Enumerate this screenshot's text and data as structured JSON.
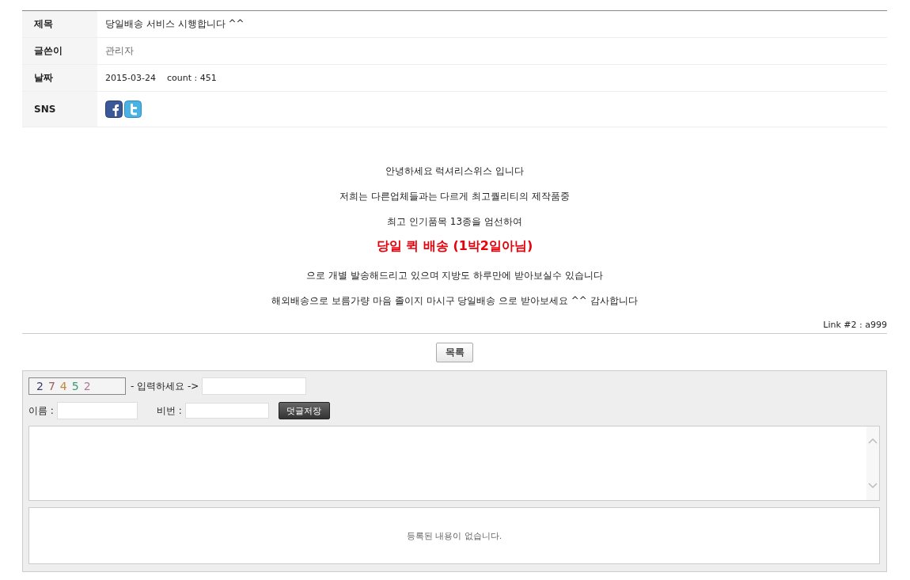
{
  "meta": [
    {
      "label": "제목",
      "kind": "text",
      "value": "당일배송 서비스 시행합니다 ^^"
    },
    {
      "label": "글쓴이",
      "kind": "muted",
      "value": "관리자"
    },
    {
      "label": "날짜",
      "kind": "date",
      "value": "2015-03-24",
      "count": "count : 451"
    },
    {
      "label": "SNS",
      "kind": "sns"
    }
  ],
  "body": [
    {
      "text": "안녕하세요 럭셔리스위스 입니다",
      "kind": "normal"
    },
    {
      "text": "저희는 다른업체들과는 다르게 최고퀄리티의 제작품중",
      "kind": "normal"
    },
    {
      "text": "최고 인기품목 13종을 엄선하여",
      "kind": "normal"
    },
    {
      "text": "당일 퀵 배송 (1박2일아님)",
      "kind": "highlight"
    },
    {
      "text": "으로 개별 발송해드리고 있으며 지방도 하루만에 받아보실수 있습니다",
      "kind": "normal"
    },
    {
      "text": "해외배송으로 보름가량 마음 졸이지 마시구 당일배송 으로 받아보세요 ^^ 감사합니다",
      "kind": "normal"
    }
  ],
  "link": "Link #2 : a999",
  "list_button": "목록",
  "comment": {
    "captcha": [
      {
        "text": "2",
        "color": "#3c3c6c"
      },
      {
        "text": "7",
        "color": "#a05a5a"
      },
      {
        "text": "4",
        "color": "#c08a3a"
      },
      {
        "text": "5",
        "color": "#3a9a7a"
      },
      {
        "text": "2",
        "color": "#b07a9a"
      }
    ],
    "captcha_label": "- 입력하세요 ->",
    "name_label": "이름 :",
    "password_label": "비번 :",
    "save_button": "덧글저장",
    "empty_message": "등록된 내용이 없습니다."
  }
}
